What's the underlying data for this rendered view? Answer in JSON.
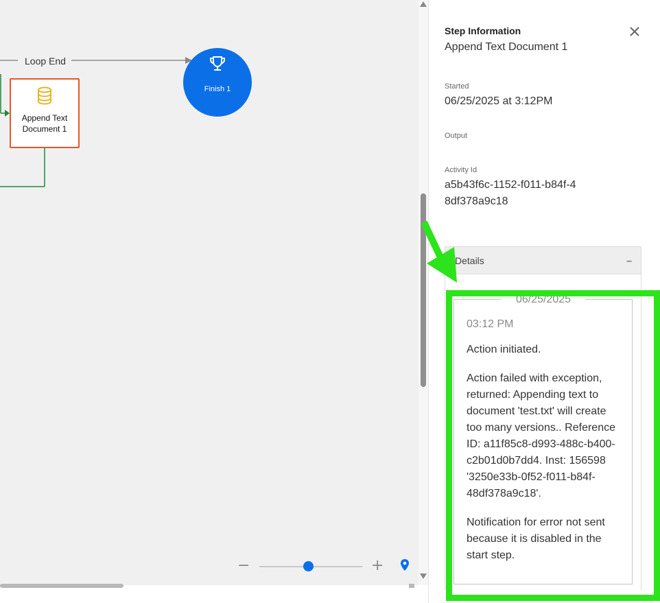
{
  "canvas": {
    "loop_end_label": "Loop End",
    "append_node_label": "Append Text Document 1",
    "finish_node_label": "Finish 1",
    "zoom_level": 0.5
  },
  "panel": {
    "title": "Step Information",
    "subtitle": "Append Text Document 1",
    "started_label": "Started",
    "started_value": "06/25/2025 at 3:12PM",
    "output_label": "Output",
    "activity_id_label": "Activity Id",
    "activity_id_value": "a5b43f6c-1152-f011-b84f-48df378a9c18",
    "details_title": "Details",
    "log": {
      "date": "06/25/2025",
      "time": "03:12 PM",
      "messages": [
        "Action initiated.",
        "Action failed with exception, returned: Appending text to document 'test.txt' will create too many versions.. Reference ID: a11f85c8-d993-488c-b400-c2b01d0b7dd4. Inst: 156598 '3250e33b-0f52-f011-b84f-48df378a9c18'.",
        "Notification for error not sent because it is disabled in the start step."
      ]
    }
  },
  "colors": {
    "accent_blue": "#0b6fe8",
    "node_border": "#e8552b",
    "connector_green": "#1e8a3c",
    "annotation_green": "#2de31b",
    "db_icon": "#e6b422"
  },
  "icons": {
    "close": "close-icon",
    "collapse": "minus-icon",
    "database": "database-icon",
    "trophy": "trophy-icon",
    "locate": "map-pin-icon"
  }
}
